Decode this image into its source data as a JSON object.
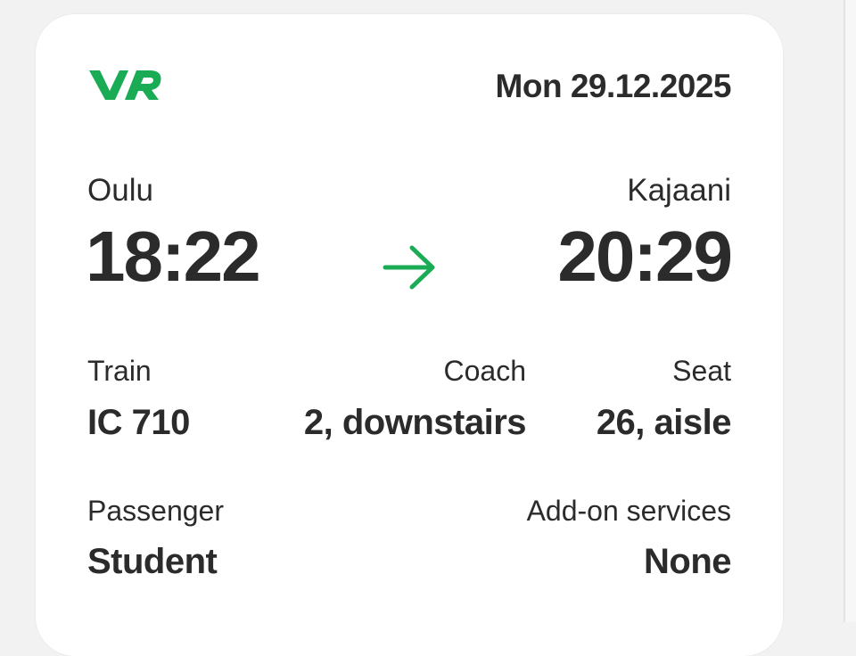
{
  "brand": {
    "logo_icon": "vr-logo-icon",
    "color": "#1aab55"
  },
  "ticket": {
    "date": "Mon 29.12.2025",
    "origin": "Oulu",
    "destination": "Kajaani",
    "departure_time": "18:22",
    "arrival_time": "20:29",
    "direction_icon": "arrow-right-icon",
    "train": {
      "label": "Train",
      "value": "IC 710"
    },
    "coach": {
      "label": "Coach",
      "value": "2, downstairs"
    },
    "seat": {
      "label": "Seat",
      "value": "26, aisle"
    },
    "passenger": {
      "label": "Passenger",
      "value": "Student"
    },
    "addons": {
      "label": "Add-on services",
      "value": "None"
    }
  }
}
